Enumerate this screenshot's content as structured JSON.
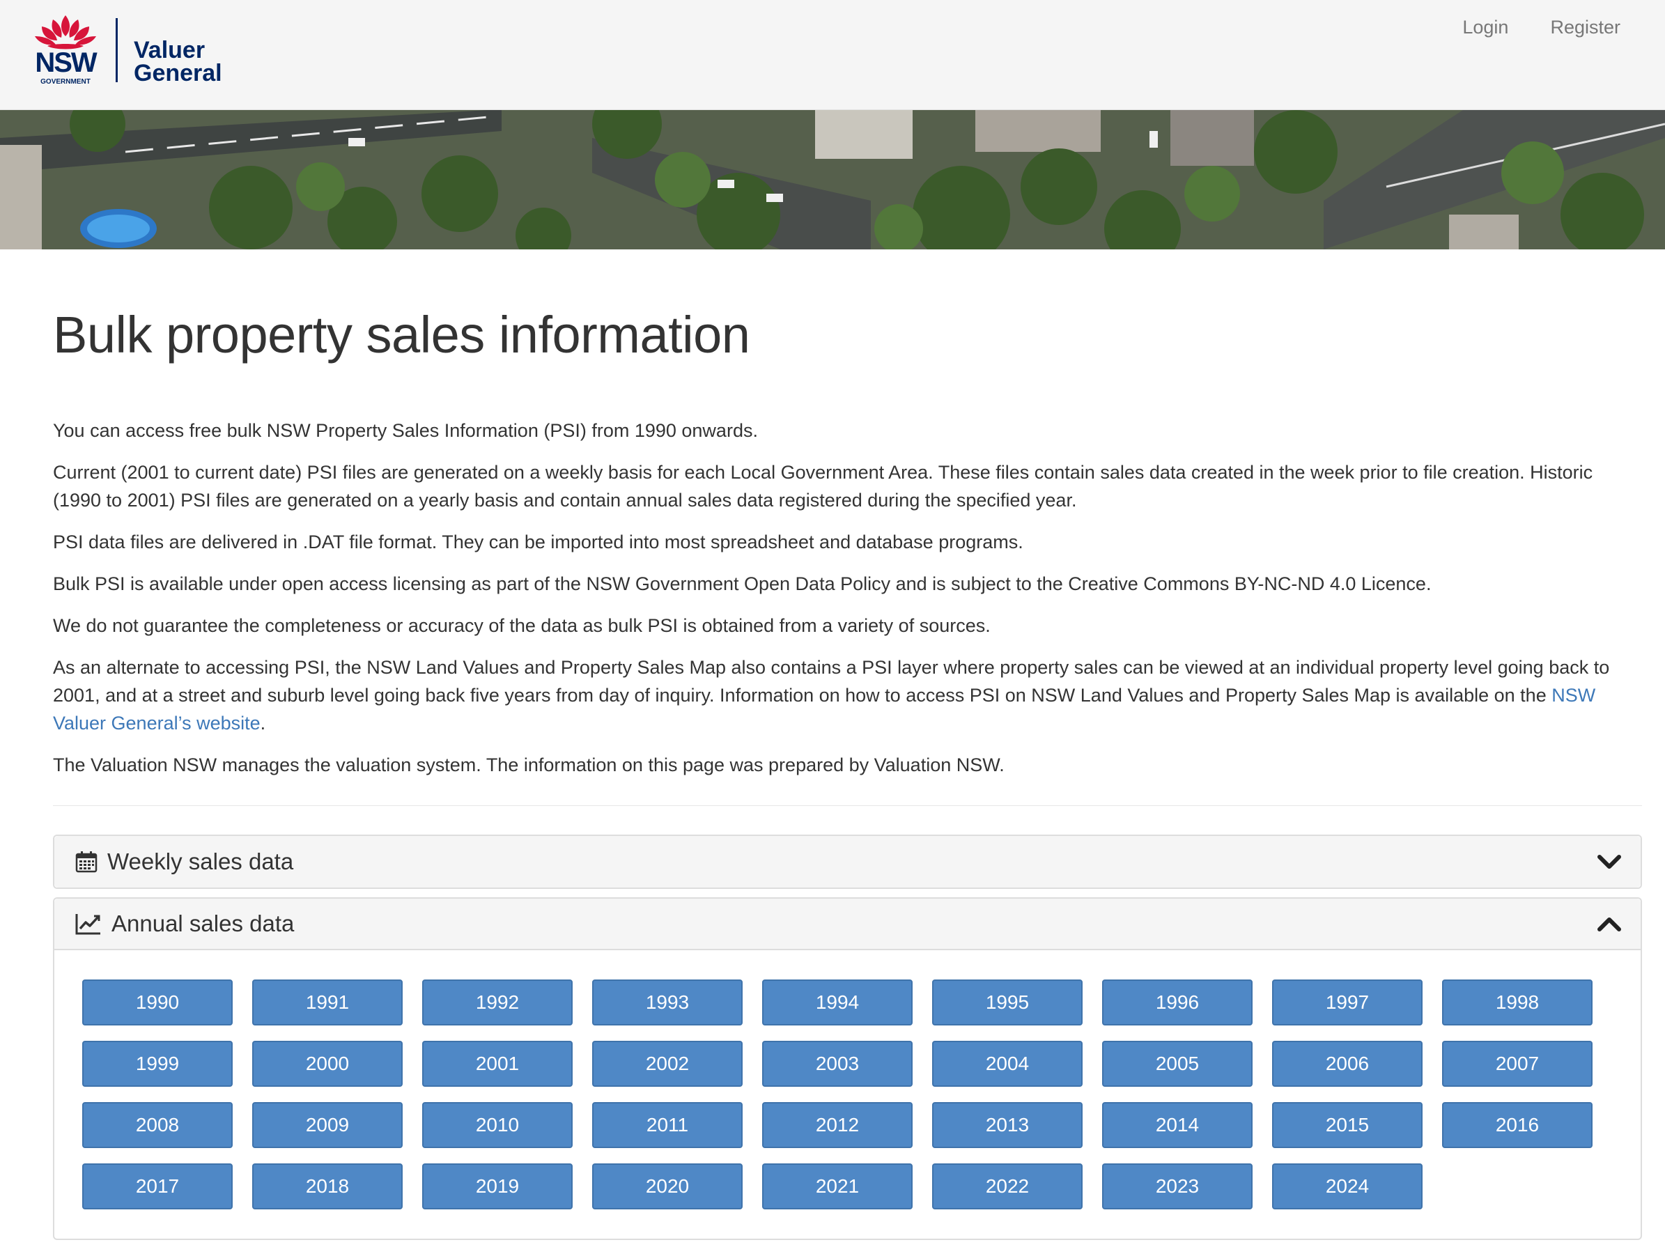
{
  "header": {
    "logo_nsw": "NSW",
    "logo_government": "GOVERNMENT",
    "logo_line1": "Valuer",
    "logo_line2": "General",
    "nav": [
      {
        "label": "Login"
      },
      {
        "label": "Register"
      }
    ]
  },
  "page": {
    "title": "Bulk property sales information",
    "paragraphs": [
      "You can access free bulk NSW Property Sales Information (PSI) from 1990 onwards.",
      "Current (2001 to current date) PSI files are generated on a weekly basis for each Local Government Area. These files contain sales data created in the week prior to file creation. Historic (1990 to 2001) PSI files are generated on a yearly basis and contain annual sales data registered during the specified year.",
      "PSI data files are delivered in .DAT file format.  They can be imported into most spreadsheet and database programs.",
      "Bulk PSI is available under open access licensing as part of the NSW Government Open Data Policy and is subject to the Creative Commons BY-NC-ND 4.0 Licence.",
      "We do not guarantee the completeness or accuracy of the data as bulk PSI is obtained from a variety of sources."
    ],
    "alt_para_before": "As an alternate to accessing PSI, the NSW Land Values and Property Sales Map also contains a PSI layer where property sales can be viewed at an individual property level going back to 2001, and at a street and suburb level going back five years from day of inquiry.  Information on how to access PSI on NSW Land Values and Property Sales Map is available on the ",
    "alt_para_link": "NSW Valuer General’s website",
    "alt_para_after": ".",
    "closing_para": "The Valuation NSW manages the valuation system. The information on this page was prepared by Valuation NSW."
  },
  "weekly_panel": {
    "title": "Weekly sales data",
    "icon": "calendar-icon",
    "state": "collapsed"
  },
  "annual_panel": {
    "title": "Annual sales data",
    "icon": "line-chart-icon",
    "state": "expanded",
    "years": [
      "1990",
      "1991",
      "1992",
      "1993",
      "1994",
      "1995",
      "1996",
      "1997",
      "1998",
      "1999",
      "2000",
      "2001",
      "2002",
      "2003",
      "2004",
      "2005",
      "2006",
      "2007",
      "2008",
      "2009",
      "2010",
      "2011",
      "2012",
      "2013",
      "2014",
      "2015",
      "2016",
      "2017",
      "2018",
      "2019",
      "2020",
      "2021",
      "2022",
      "2023",
      "2024"
    ]
  },
  "colors": {
    "button": "#4f88c6",
    "link": "#3d78b8",
    "brand": "#002664",
    "waratah": "#d7153a"
  }
}
